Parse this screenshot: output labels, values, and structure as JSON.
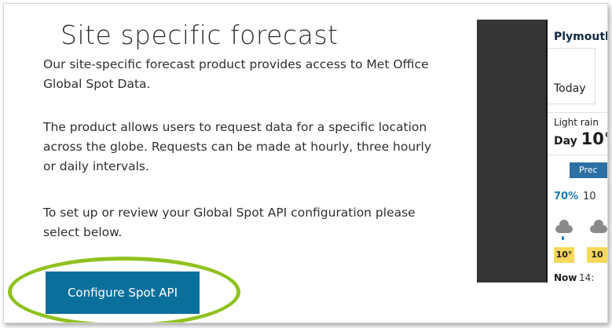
{
  "content": {
    "title": "Site specific forecast",
    "paragraph1": "Our site-specific forecast product provides access to Met Office Global Spot Data.",
    "paragraph2": "The product allows users to request data for a specific location across the globe. Requests can be made at hourly, three hourly or daily intervals.",
    "paragraph3": "To set up or review your Global Spot API configuration please select below.",
    "button_label": "Configure Spot API"
  },
  "phone_preview": {
    "location": "Plymoutl",
    "tab_today": "Today",
    "condition": "Light rain",
    "day_label": "Day",
    "day_temp": "10°",
    "pill_label": "Prec",
    "precip_pct": "70%",
    "precip_next": "10",
    "temp1": "10°",
    "temp2": "10",
    "now_label": "Now",
    "time_label": "14:"
  },
  "colors": {
    "button_bg": "#0b6f9c",
    "highlight": "#8fc21f",
    "temp_badge": "#f7d85a"
  }
}
